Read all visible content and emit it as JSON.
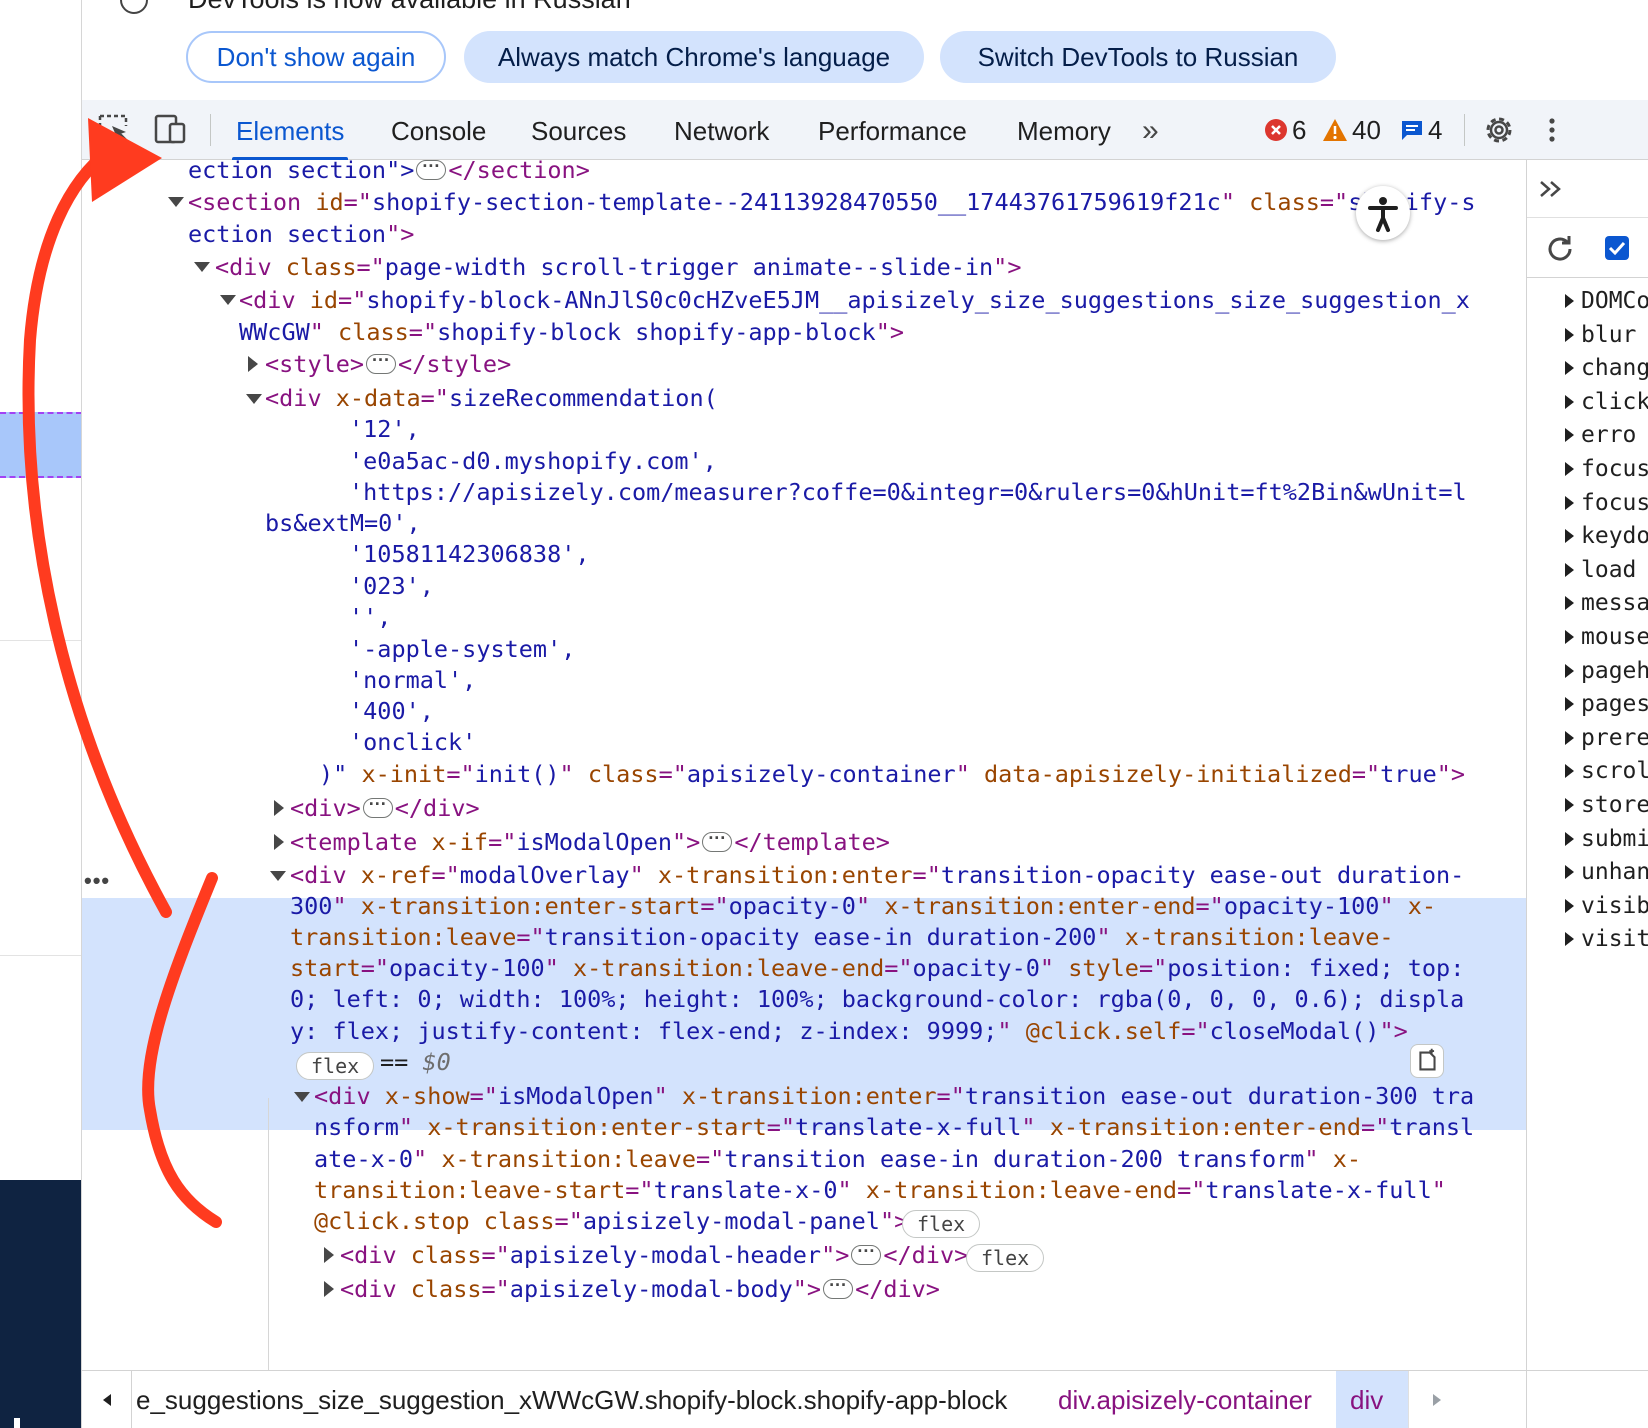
{
  "infobar": {
    "message": "DevTools is now available in Russian",
    "buttons": [
      "Don't show again",
      "Always match Chrome's language",
      "Switch DevTools to Russian"
    ]
  },
  "toolbar": {
    "tabs": [
      "Elements",
      "Console",
      "Sources",
      "Network",
      "Performance",
      "Memory"
    ],
    "active_tab": "Elements",
    "more_tabs_glyph": "»",
    "errors": "6",
    "warnings": "40",
    "messages": "4"
  },
  "dom": {
    "l01": {
      "a": "ection section\">",
      "b": "</section>"
    },
    "l02": {
      "a": "<section ",
      "an1": "id",
      "eq1": "=\"",
      "av1": "shopify-section-template--24113928470550__17443761759619f21c",
      "q1": "\" ",
      "an2": "class",
      "eq2": "=\"",
      "av2": "shopify-s"
    },
    "l03": {
      "a": "ection section",
      "b": "\">"
    },
    "l04": {
      "t": "<div ",
      "an": "class",
      "eq": "=\"",
      "av": "page-width scroll-trigger animate--slide-in",
      "e": "\">"
    },
    "l05": {
      "t": "<div ",
      "an": "id",
      "eq": "=\"",
      "av": "shopify-block-ANnJlS0c0cHZveE5JM__apisizely_size_suggestions_size_suggestion_x"
    },
    "l06": {
      "av": "WWcGW",
      "q": "\" ",
      "an": "class",
      "eq": "=\"",
      "av2": "shopify-block shopify-app-block",
      "e": "\">"
    },
    "l07": {
      "a": "<style>",
      "b": "</style>"
    },
    "l08": {
      "t": "<div ",
      "an": "x-data",
      "eq": "=\"",
      "av": "sizeRecommendation("
    },
    "l09": "'12',",
    "l10": "'e0a5ac-d0.myshopify.com',",
    "l11": "'https://apisizely.com/measurer?coffe=0&integr=0&rulers=0&hUnit=ft%2Bin&wUnit=l",
    "l12": "bs&extM=0',",
    "l13": "'10581142306838',",
    "l14": "'023',",
    "l15": "'',",
    "l16": "'-apple-system',",
    "l17": "'normal',",
    "l18": "'400',",
    "l19": "'onclick'",
    "l20": {
      "av": ")\" ",
      "an1": "x-init",
      "eq1": "=\"",
      "av1": "init()",
      "q1": "\" ",
      "an2": "class",
      "eq2": "=\"",
      "av2": "apisizely-container",
      "q2": "\" ",
      "an3": "data-apisizely-initialized",
      "eq3": "=\"",
      "av3": "true",
      "e": "\">"
    },
    "l21": {
      "a": "<div>",
      "b": "</div>"
    },
    "l22": {
      "t": "<template ",
      "an": "x-if",
      "eq": "=\"",
      "av": "isModalOpen",
      "e": "\">",
      "b": "</template>"
    },
    "l23": {
      "t": "<div ",
      "an1": "x-ref",
      "eq1": "=\"",
      "av1": "modalOverlay",
      "q1": "\" ",
      "an2": "x-transition:enter",
      "eq2": "=\"",
      "av2": "transition-opacity ease-out duration-"
    },
    "l24": {
      "av": "300",
      "q": "\" ",
      "an1": "x-transition:enter-start",
      "eq1": "=\"",
      "av1": "opacity-0",
      "q1": "\" ",
      "an2": "x-transition:enter-end",
      "eq2": "=\"",
      "av2": "opacity-100",
      "q2": "\" ",
      "an3": "x-"
    },
    "l25": {
      "an": "transition:leave",
      "eq": "=\"",
      "av": "transition-opacity ease-in duration-200",
      "q": "\" ",
      "an2": "x-transition:leave-"
    },
    "l26": {
      "an": "start",
      "eq": "=\"",
      "av": "opacity-100",
      "q": "\" ",
      "an2": "x-transition:leave-end",
      "eq2": "=\"",
      "av2": "opacity-0",
      "q2": "\" ",
      "an3": "style",
      "eq3": "=\"",
      "av3": "position: fixed; top:"
    },
    "l27": {
      "av": "0; left: 0; width: 100%; height: 100%; background-color: rgba(0, 0, 0, 0.6); displa"
    },
    "l28": {
      "av": "y: flex; justify-content: flex-end; z-index: 9999;",
      "q": "\" ",
      "an": "@click.self",
      "eq": "=\"",
      "av2": "closeModal()",
      "e": "\">"
    },
    "l29": {
      "badge": "flex",
      "eq": "== ",
      "sel": "$0"
    },
    "l30": {
      "t": "<div ",
      "an1": "x-show",
      "eq1": "=\"",
      "av1": "isModalOpen",
      "q1": "\" ",
      "an2": "x-transition:enter",
      "eq2": "=\"",
      "av2": "transition ease-out duration-300 tra"
    },
    "l31": {
      "av": "nsform",
      "q": "\" ",
      "an1": "x-transition:enter-start",
      "eq1": "=\"",
      "av1": "translate-x-full",
      "q1": "\" ",
      "an2": "x-transition:enter-end",
      "eq2": "=\"",
      "av2": "transl"
    },
    "l32": {
      "av": "ate-x-0",
      "q": "\" ",
      "an1": "x-transition:leave",
      "eq1": "=\"",
      "av1": "transition ease-in duration-200 transform",
      "q1": "\" ",
      "an2": "x-"
    },
    "l33": {
      "an": "transition:leave-start",
      "eq": "=\"",
      "av": "translate-x-0",
      "q": "\" ",
      "an2": "x-transition:leave-end",
      "eq2": "=\"",
      "av2": "translate-x-full",
      "e": "\""
    },
    "l34": {
      "an": "@click.stop",
      "sp": " ",
      "an2": "class",
      "eq": "=\"",
      "av": "apisizely-modal-panel",
      "e": "\">",
      "badge": "flex"
    },
    "l35": {
      "t": "<div ",
      "an": "class",
      "eq": "=\"",
      "av": "apisizely-modal-header",
      "e": "\">",
      "b": "</div>",
      "badge": "flex"
    },
    "l36": {
      "t": "<div ",
      "an": "class",
      "eq": "=\"",
      "av": "apisizely-modal-body",
      "e": "\">",
      "b": "</div>"
    }
  },
  "event_listeners": [
    "DOMCo",
    "blur",
    "chang",
    "click",
    "erro",
    "focus",
    "focus",
    "keydo",
    "load",
    "messa",
    "mouse",
    "pageh",
    "pages",
    "prere",
    "scrol",
    "store",
    "submi",
    "unhan",
    "visib",
    "visit"
  ],
  "breadcrumbs": {
    "items": [
      "e_suggestions_size_suggestion_xWWcGW.shopify-block.shopify-app-block",
      "div.apisizely-container",
      "div"
    ],
    "colors": [
      "#1f1f1f",
      "#881280",
      "#881280"
    ]
  },
  "colors": {
    "accent": "#0b57d0",
    "tag": "#881280",
    "attr_name": "#994500",
    "attr_value": "#1a1aa6",
    "selection": "#d3e3fd",
    "annotation_arrow": "#ff3b1f",
    "error": "#dc362e",
    "warning": "#e37400"
  },
  "icons": [
    "inspect-element-icon",
    "device-toolbar-icon",
    "more-tabs-icon",
    "error-icon",
    "warning-icon",
    "message-icon",
    "settings-gear-icon",
    "kebab-menu-icon",
    "accessibility-icon",
    "refresh-icon",
    "checkbox-icon",
    "copy-icon",
    "left-arrow-icon",
    "right-arrow-icon",
    "info-icon"
  ]
}
